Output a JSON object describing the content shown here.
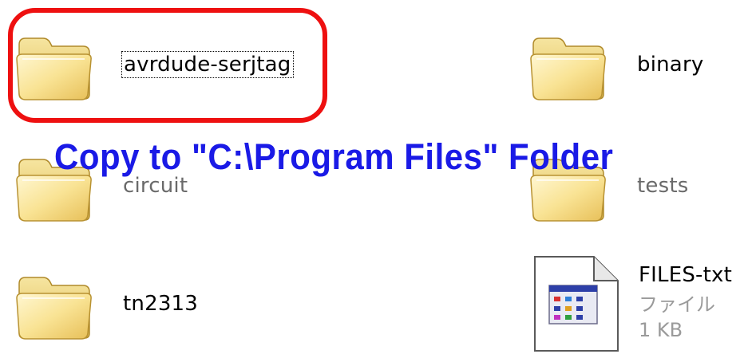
{
  "items": [
    {
      "name": "avrdude-serjtag",
      "type": "folder",
      "selected": true
    },
    {
      "name": "binary",
      "type": "folder",
      "selected": false
    },
    {
      "name": "circuit",
      "type": "folder",
      "selected": false
    },
    {
      "name": "tests",
      "type": "folder",
      "selected": false
    },
    {
      "name": "tn2313",
      "type": "folder",
      "selected": false
    },
    {
      "name": "FILES-txt",
      "type": "file",
      "kind": "ファイル",
      "size": "1 KB",
      "selected": false
    }
  ],
  "annotation": {
    "text": "Copy to \"C:\\Program Files\" Folder",
    "color": "#1a1ae6"
  },
  "highlight": {
    "color": "#ee1010"
  },
  "icons": {
    "folder": "folder-icon",
    "file": "document-icon"
  }
}
